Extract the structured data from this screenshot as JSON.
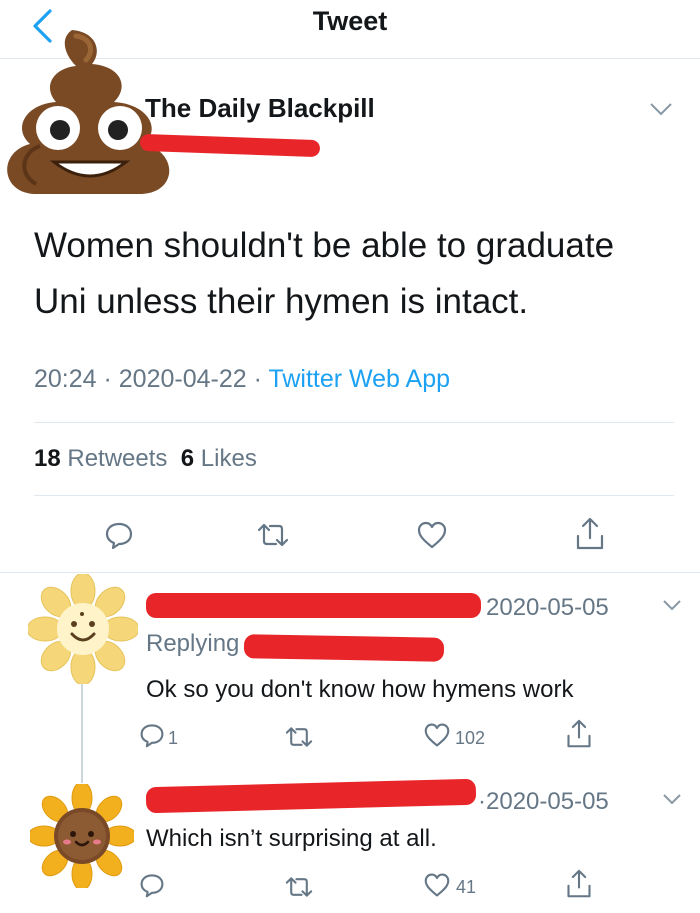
{
  "header": {
    "title": "Tweet"
  },
  "tweet": {
    "author_name": "The Daily Blackpill",
    "text": "Women shouldn't be able to graduate Uni unless their hymen is intact.",
    "time": "20:24",
    "date": "2020-04-22",
    "source": "Twitter Web App",
    "retweets_count": "18",
    "retweets_label": "Retweets",
    "likes_count": "6",
    "likes_label": "Likes"
  },
  "replies": [
    {
      "date": "2020-05-05",
      "replying_label": "Replying",
      "text": "Ok so you don't know how hymens work",
      "reply_count": "1",
      "like_count": "102"
    },
    {
      "date": "2020-05-05",
      "text": "Which isn’t surprising at all.",
      "like_count": "41"
    }
  ],
  "colors": {
    "accent": "#1da1f2",
    "muted": "#657786",
    "redaction": "#e8262a"
  },
  "icons": [
    "back-chevron-icon",
    "poop-emoji-avatar",
    "flower-avatar",
    "sunflower-avatar",
    "reply-icon",
    "retweet-icon",
    "like-icon",
    "share-icon",
    "chevron-down-icon"
  ]
}
